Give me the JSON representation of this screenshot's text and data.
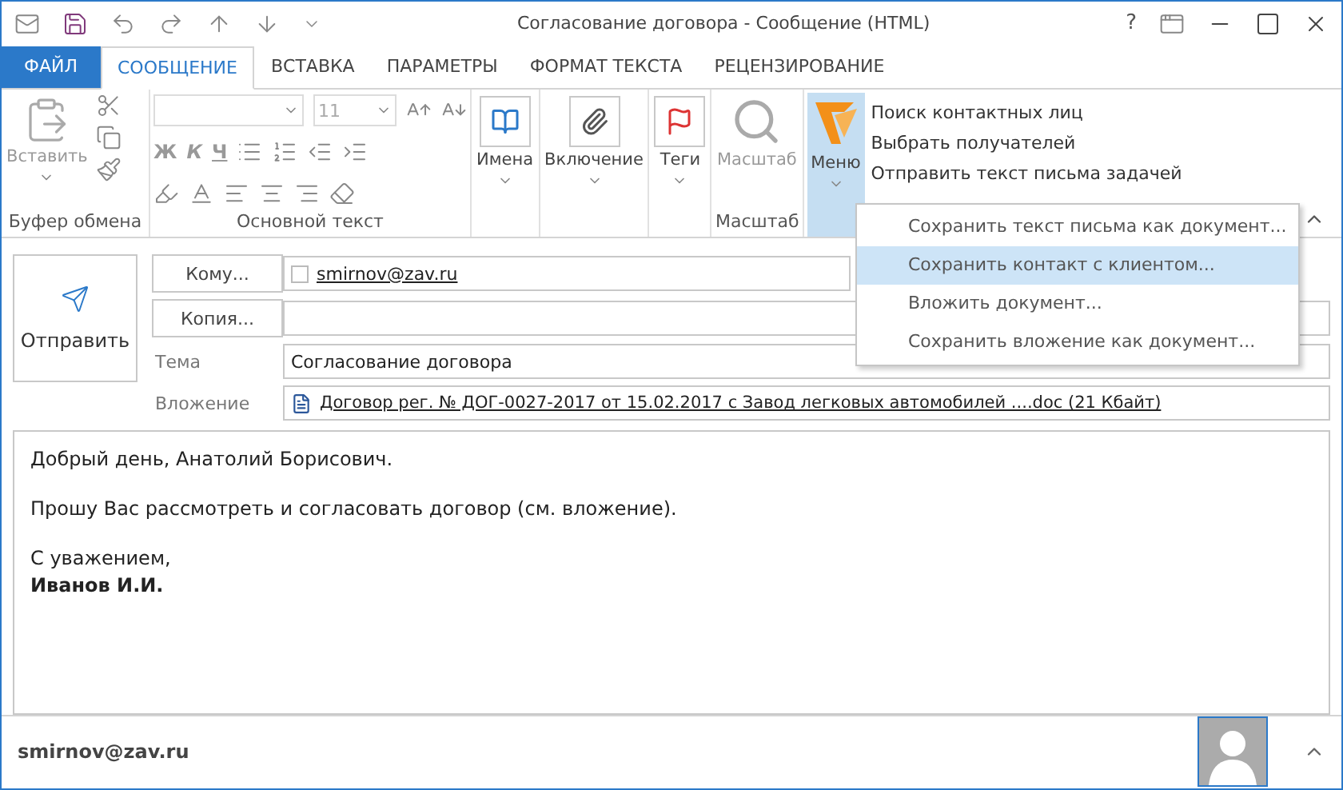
{
  "window": {
    "title": "Согласование договора - Сообщение (HTML)",
    "help": "?"
  },
  "tabs": [
    {
      "label": "ФАЙЛ",
      "kind": "file",
      "selected": false
    },
    {
      "label": "СООБЩЕНИЕ",
      "kind": "tab",
      "selected": true
    },
    {
      "label": "ВСТАВКА",
      "kind": "tab",
      "selected": false
    },
    {
      "label": "ПАРАМЕТРЫ",
      "kind": "tab",
      "selected": false
    },
    {
      "label": "ФОРМАТ ТЕКСТА",
      "kind": "tab",
      "selected": false
    },
    {
      "label": "РЕЦЕНЗИРОВАНИЕ",
      "kind": "tab",
      "selected": false
    }
  ],
  "ribbon": {
    "clipboard": {
      "paste": "Вставить",
      "group_label": "Буфер обмена"
    },
    "basic_text": {
      "font_size": "11",
      "bold": "Ж",
      "italic": "К",
      "underline": "Ч",
      "group_label": "Основной текст"
    },
    "names": "Имена",
    "include": "Включение",
    "tags": "Теги",
    "zoom": {
      "button": "Масштаб",
      "group_label": "Масштаб"
    },
    "menu": {
      "button": "Меню",
      "commands": [
        "Поиск контактных лиц",
        "Выбрать получателей",
        "Отправить текст письма задачей"
      ]
    }
  },
  "dropdown": [
    {
      "label": "Сохранить текст письма как документ...",
      "selected": false
    },
    {
      "label": "Сохранить контакт с клиентом...",
      "selected": true
    },
    {
      "label": "Вложить документ...",
      "selected": false
    },
    {
      "label": "Сохранить вложение как документ...",
      "selected": false
    }
  ],
  "header": {
    "send": "Отправить",
    "to_button": "Кому...",
    "to_value": "smirnov@zav.ru",
    "to_checked": false,
    "cc_button": "Копия...",
    "subject_label": "Тема",
    "subject_value": "Согласование договора",
    "attachment_label": "Вложение",
    "attachment_value": "Договор рег. № ДОГ-0027-2017 от 15.02.2017 с Завод легковых автомобилей ....doc (21 Кбайт)"
  },
  "body": [
    {
      "lines": [
        {
          "text": "Добрый день, Анатолий Борисович.",
          "bold": false
        }
      ]
    },
    {
      "lines": [
        {
          "text": "Прошу Вас рассмотреть и согласовать договор (см. вложение).",
          "bold": false
        }
      ]
    },
    {
      "lines": [
        {
          "text": "С уважением,",
          "bold": false
        },
        {
          "text": "Иванов И.И.",
          "bold": true
        }
      ]
    }
  ],
  "footer": {
    "email": "smirnov@zav.ru"
  }
}
